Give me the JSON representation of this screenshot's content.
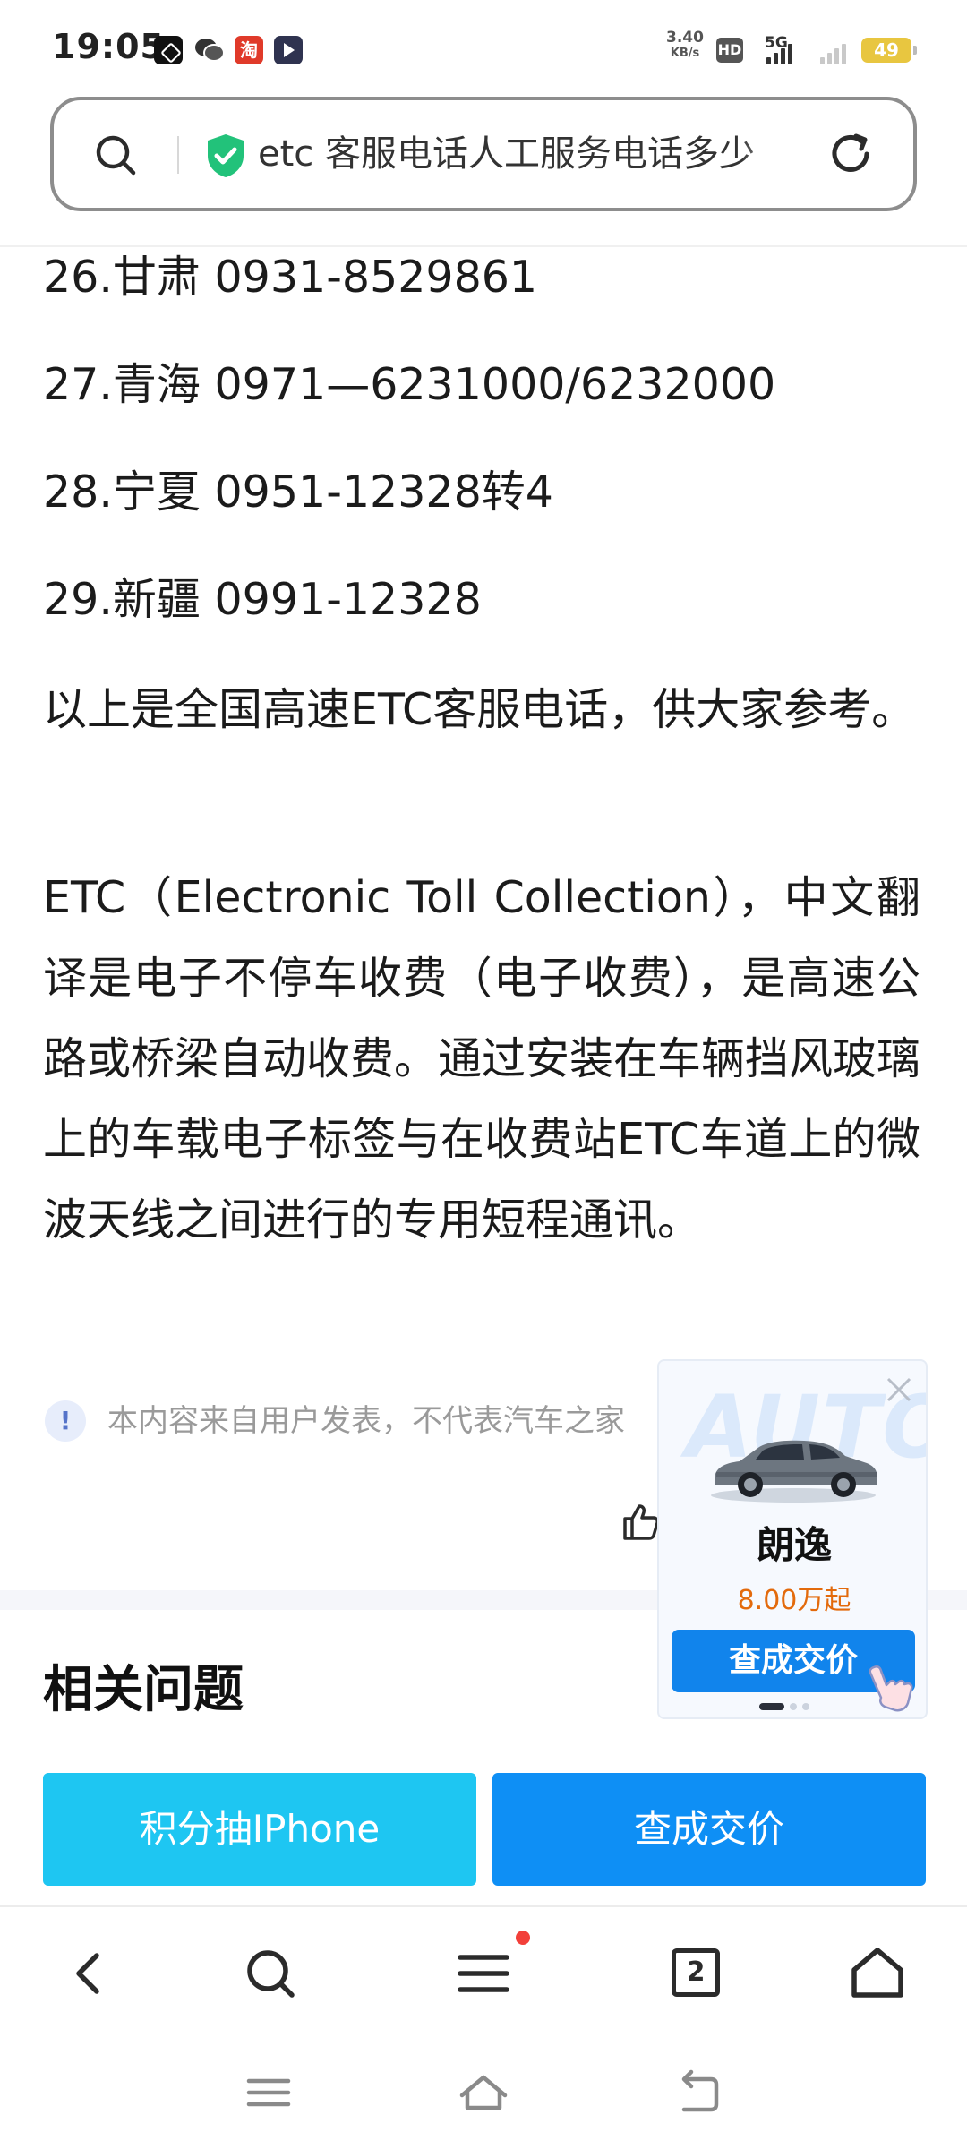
{
  "status_bar": {
    "time": "19:05",
    "net_speed_value": "3.40",
    "net_speed_unit": "KB/s",
    "hd": "HD",
    "network": "5G",
    "battery": "49",
    "app_icons": [
      "capcut-icon",
      "wechat-icon",
      "taobao-icon",
      "video-app-icon"
    ]
  },
  "address_bar": {
    "url_text": "etc 客服电话人工服务电话多少",
    "secure": true
  },
  "article": {
    "items": [
      "26.甘肃 0931-8529861",
      "27.青海 0971—6231000/6232000",
      "28.宁夏 0951-12328转4",
      "29.新疆 0991-12328"
    ],
    "summary": "以上是全国高速ETC客服电话，供大家参考。",
    "definition": "ETC（Electronic Toll Collection），中文翻译是电子不停车收费（电子收费），是高速公路或桥梁自动收费。通过安装在车辆挡风玻璃上的车载电子标签与在收费站ETC车道上的微波天线之间进行的专用短程通讯。"
  },
  "disclaimer": {
    "icon": "!",
    "text": "本内容来自用户发表，不代表汽车之家"
  },
  "related": {
    "title": "相关问题",
    "buttons": [
      "积分抽IPhone",
      "查成交价"
    ]
  },
  "ad": {
    "watermark": "AUTO",
    "car_name": "朗逸",
    "price": "8.00万起",
    "cta": "查成交价"
  },
  "toolbar": {
    "tab_count": "2"
  },
  "colors": {
    "accent_cyan": "#1ec6f2",
    "accent_blue": "#0e8ff5",
    "price_orange": "#e36a0c",
    "secure_green": "#22c27a"
  }
}
